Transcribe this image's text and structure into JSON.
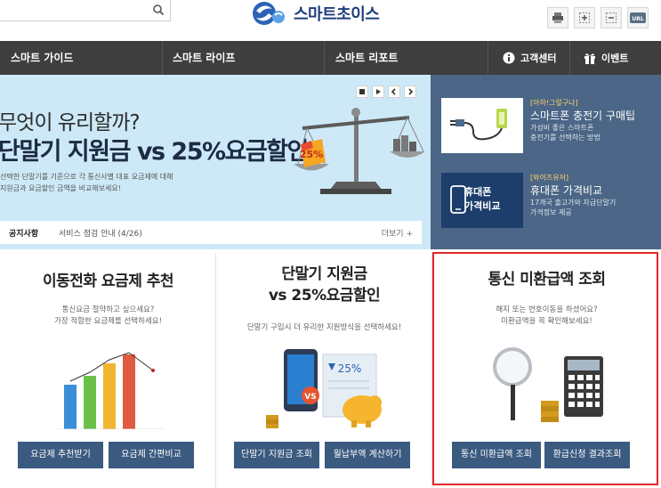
{
  "header": {
    "search": {
      "placeholder": ""
    },
    "logo_text": "스마트초이스"
  },
  "nav": {
    "items": [
      "스마트 가이드",
      "스마트 라이프",
      "스마트 리포트"
    ],
    "customer_center": "고객센터",
    "events": "이벤트"
  },
  "hero": {
    "title_line1": "무엇이 유리할까?",
    "title_line2": "단말기 지원금 vs 25%요금할인",
    "desc_line1": "선택한 단말기를 기준으로 각 통신사별 대표 요금제에 대해",
    "desc_line2": "지원금과 요금할인 금액을 비교해보세요!",
    "badge": "25%"
  },
  "notice": {
    "label": "공지사항",
    "text": "서비스 점검 안내 (4/26)",
    "more": "더보기 +"
  },
  "promos": [
    {
      "tag": "[아하!그렇구나]",
      "title": "스마트폰 충전기 구매팁",
      "desc_line1": "가성비 좋은 스마트폰",
      "desc_line2": "충전기를 선택하는 방법"
    },
    {
      "tag": "[와이즈유저]",
      "title": "휴대폰 가격비교",
      "desc_line1": "17개국 출고가와 자급단말기",
      "desc_line2": "가격정보 제공",
      "thumb_line1": "휴대폰",
      "thumb_line2": "가격비교"
    }
  ],
  "panels": [
    {
      "title_line1": "이동전화 요금제 추천",
      "desc_line1": "통신요금 절약하고 싶으세요?",
      "desc_line2": "가장 적합한 요금제를 선택하세요!",
      "buttons": [
        "요금제 추천받기",
        "요금제 간편비교"
      ]
    },
    {
      "title_line1": "단말기 지원금",
      "title_line2": "vs 25%요금할인",
      "desc_line1": "단말기 구입시 더 유리한 지원방식을 선택하세요!",
      "badge_pct": "25%",
      "badge_vs": "VS",
      "buttons": [
        "단말기 지원금 조회",
        "월납부액 계산하기"
      ]
    },
    {
      "title_line1": "통신 미환급액 조회",
      "desc_line1": "해지 또는 번호이동을 하셨어요?",
      "desc_line2": "미환급액을 꼭 확인해보세요!",
      "buttons": [
        "통신 미환급액 조회",
        "환급신청 결과조회"
      ]
    }
  ],
  "colors": {
    "nav_bg": "#3e3e3e",
    "hero_bg": "#cde9f7",
    "promo_bg": "#4b6686",
    "button_bg": "#3b5a80",
    "highlight": "#e3262b"
  },
  "icons": [
    "search-icon",
    "print-icon",
    "zoom-in-icon",
    "zoom-out-icon",
    "url-icon",
    "info-icon",
    "gift-icon",
    "stop-icon",
    "play-icon",
    "prev-icon",
    "next-icon"
  ]
}
